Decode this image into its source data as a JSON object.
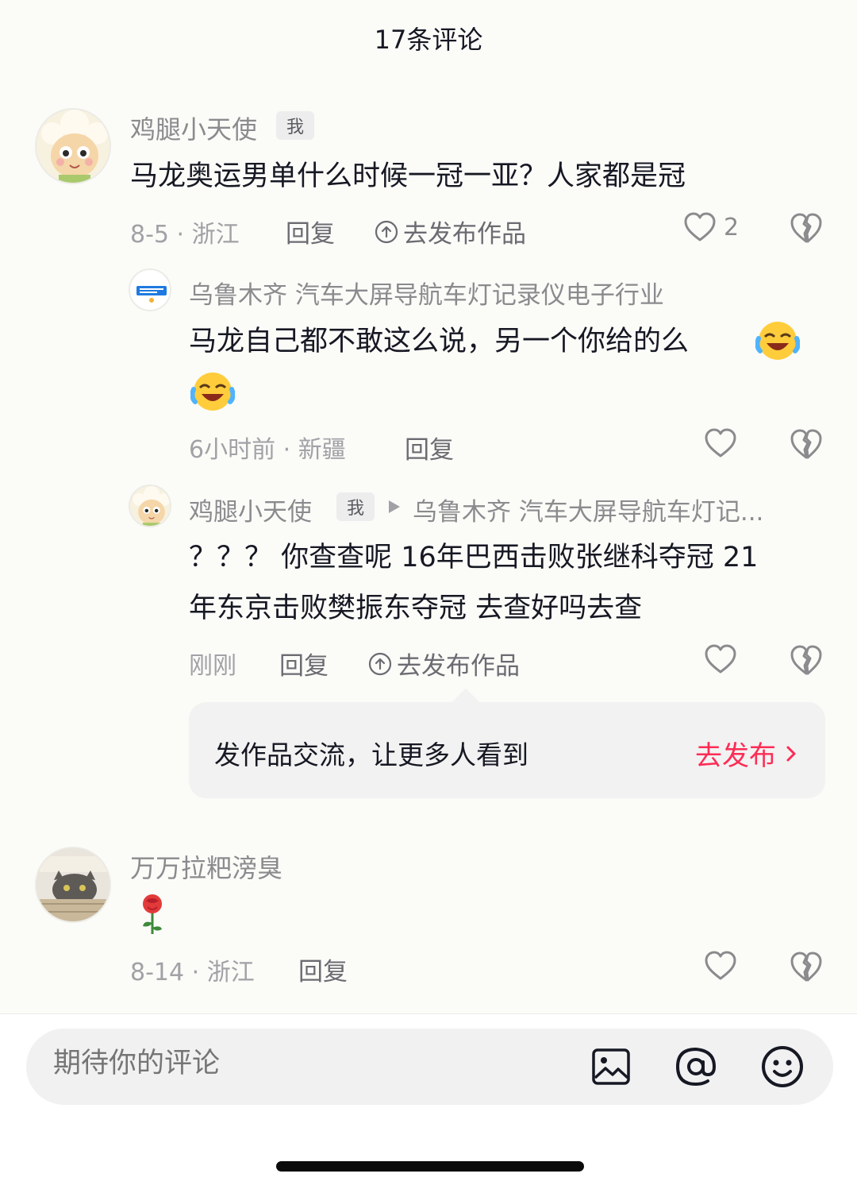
{
  "header": {
    "title": "17条评论"
  },
  "comments": [
    {
      "author": "鸡腿小天使",
      "me_tag": "我",
      "text": "马龙奥运男单什么时候一冠一亚？人家都是冠",
      "date": "8-5",
      "location": "浙江",
      "reply_label": "回复",
      "publish_label": "去发布作品",
      "like_count": "2",
      "avatar_icon": "cartoon-sheep-avatar"
    },
    {
      "author": "乌鲁木齐 汽车大屏导航车灯记录仪电子行业",
      "text": "马龙自己都不敢这么说，另一个你给的么",
      "time": "6小时前 · 新疆",
      "reply_label": "回复",
      "avatar_icon": "shop-logo-avatar",
      "emoji_icon": "laughing-crying-emoji"
    },
    {
      "author": "鸡腿小天使",
      "me_tag": "我",
      "reply_to": "乌鲁木齐 汽车大屏导航车灯记...",
      "text_line1": "？？？ 你查查呢 16年巴西击败张继科夺冠  21",
      "text_line2": "年东京击败樊振东夺冠  去查好吗去查",
      "time": "刚刚",
      "reply_label": "回复",
      "publish_label": "去发布作品",
      "avatar_icon": "cartoon-sheep-avatar"
    },
    {
      "author": "万万拉粑滂臭",
      "date": "8-14",
      "location": "浙江",
      "reply_label": "回复",
      "avatar_icon": "cat-photo-avatar",
      "emoji_icon": "rose-emoji"
    }
  ],
  "promo": {
    "text": "发作品交流，让更多人看到",
    "action": "去发布"
  },
  "composer": {
    "placeholder": "期待你的评论",
    "icons": [
      "image-icon",
      "at-icon",
      "emoji-icon"
    ]
  },
  "colors": {
    "accent": "#fe2c55",
    "text": "#161823",
    "muted": "#8b8b8e"
  }
}
